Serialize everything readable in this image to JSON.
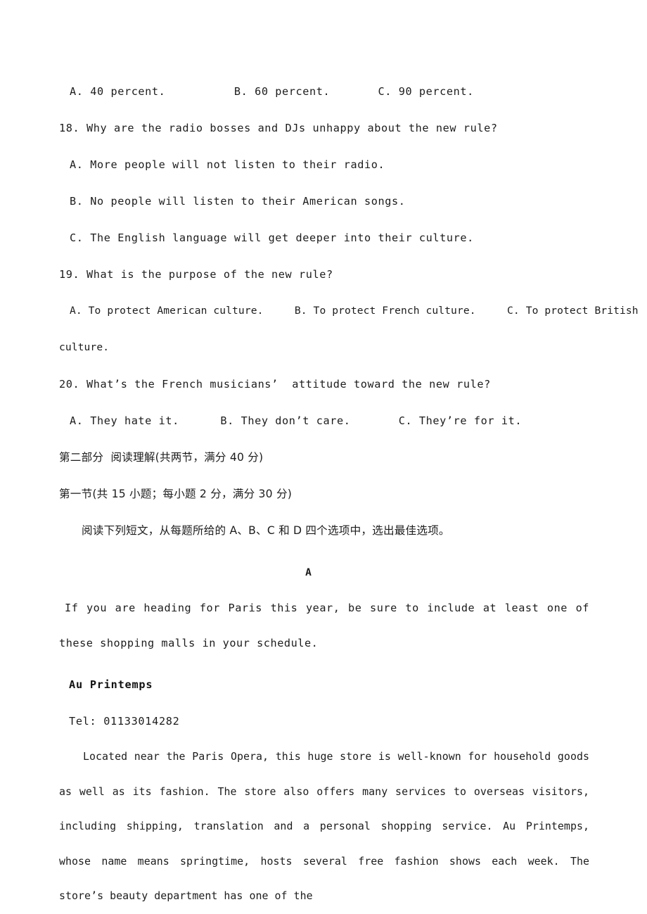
{
  "document": {
    "page_background": "#ffffff",
    "text_color": "#1c1c1c"
  },
  "listening_questions": {
    "q17_options_line": "A. 40 percent.          B. 60 percent.       C. 90 percent.",
    "q18": {
      "stem": "18. Why are the radio bosses and DJs unhappy about the new rule?",
      "options": [
        "A. More people will not listen to their radio.",
        "B. No people will listen to their American songs.",
        "C. The English language will get deeper into their culture."
      ]
    },
    "q19": {
      "stem": "19. What is the purpose of the new rule?",
      "options_line": "A. To protect American culture.     B. To protect French culture.     C. To protect British",
      "options_continuation": "culture."
    },
    "q20": {
      "stem": "20. What’s the French musicians’  attitude toward the new rule?",
      "options_line": "A. They hate it.      B. They don’t care.       C. They’re for it."
    }
  },
  "section_two": {
    "part_heading": "第二部分  阅读理解(共两节，满分 40 分)",
    "subsection_heading": "第一节(共 15 小题；每小题 2 分，满分 30 分)",
    "instruction": "阅读下列短文，从每题所给的 A、B、C 和 D 四个选项中，选出最佳选项。"
  },
  "passage_a": {
    "letter": "A",
    "intro": "If you are heading for Paris this year, be sure to include at least one of these shopping malls in your schedule.",
    "store_name": "Au Printemps",
    "telephone": "Tel: 01133014282",
    "description": "Located near the Paris Opera, this huge store is well-known for household goods as well as its fashion. The store also offers many services to overseas visitors, including shipping, translation and a personal shopping service. Au Printemps, whose name means springtime, hosts several free fashion shows each week. The store’s beauty department has one of the"
  }
}
